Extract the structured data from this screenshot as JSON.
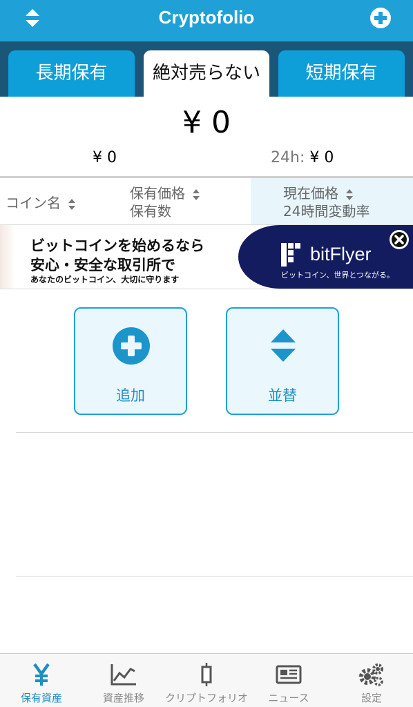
{
  "header": {
    "title": "Cryptofolio"
  },
  "tabs": [
    {
      "label": "長期保有"
    },
    {
      "label": "絶対売らない"
    },
    {
      "label": "短期保有"
    }
  ],
  "summary": {
    "total": "¥ 0",
    "holding": "¥ 0",
    "change_label": "24h:",
    "change_value": "¥ 0"
  },
  "columns": {
    "coin_name": "コイン名",
    "holding_price": "保有価格",
    "holding_qty": "保有数",
    "current_price": "現在価格",
    "change_rate": "24時間変動率"
  },
  "ad": {
    "line1": "ビットコインを始めるなら",
    "line2": "安心・安全な取引所で",
    "line3": "あなたのビットコイン、大切に守ります",
    "brand": "bitFlyer",
    "tagline": "ビットコイン、世界とつながる。"
  },
  "actions": {
    "add_label": "追加",
    "sort_label": "並替"
  },
  "bottom_nav": [
    {
      "label": "保有資産",
      "icon": "yen-icon",
      "active": true
    },
    {
      "label": "資産推移",
      "icon": "chart-icon",
      "active": false
    },
    {
      "label": "クリプトフォリオ",
      "icon": "candlestick-icon",
      "active": false
    },
    {
      "label": "ニュース",
      "icon": "newspaper-icon",
      "active": false
    },
    {
      "label": "設定",
      "icon": "gears-icon",
      "active": false
    }
  ],
  "colors": {
    "accent": "#1fa1d8",
    "tab_bar": "#1b5678",
    "ad_navy": "#131c5e"
  }
}
